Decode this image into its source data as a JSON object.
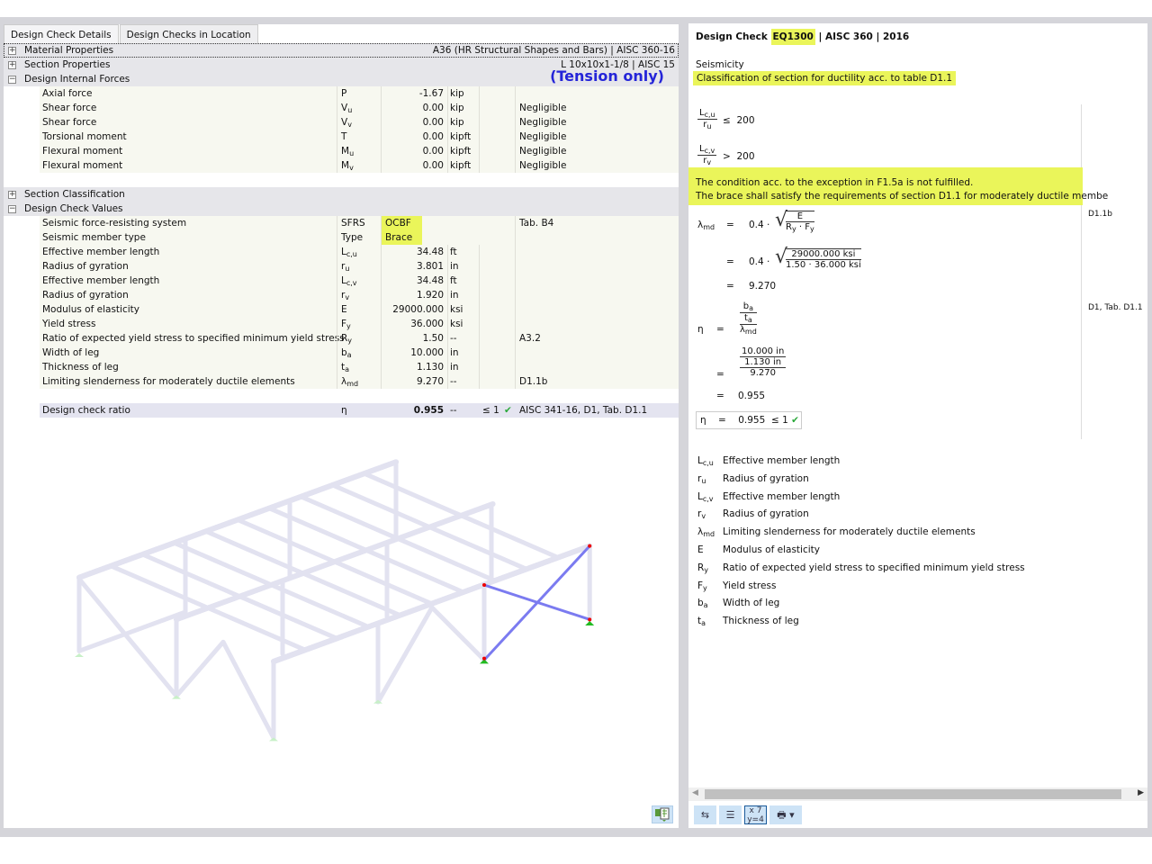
{
  "tabs": [
    "Design Check Details",
    "Design Checks in Location"
  ],
  "sections": {
    "material": {
      "label": "Material Properties",
      "value": "A36 (HR Structural Shapes and Bars) | AISC 360-16"
    },
    "section": {
      "label": "Section Properties",
      "value": "L 10x10x1-1/8 | AISC 15"
    },
    "forces": {
      "label": "Design Internal Forces",
      "note": "(Tension only)"
    },
    "classification": {
      "label": "Section Classification"
    },
    "values": {
      "label": "Design Check Values"
    }
  },
  "forces": [
    {
      "name": "Axial force",
      "sym": "P",
      "sub": "",
      "val": "-1.67",
      "unit": "kip",
      "ref": ""
    },
    {
      "name": "Shear force",
      "sym": "V",
      "sub": "u",
      "val": "0.00",
      "unit": "kip",
      "ref": "Negligible"
    },
    {
      "name": "Shear force",
      "sym": "V",
      "sub": "v",
      "val": "0.00",
      "unit": "kip",
      "ref": "Negligible"
    },
    {
      "name": "Torsional moment",
      "sym": "T",
      "sub": "",
      "val": "0.00",
      "unit": "kipft",
      "ref": "Negligible"
    },
    {
      "name": "Flexural moment",
      "sym": "M",
      "sub": "u",
      "val": "0.00",
      "unit": "kipft",
      "ref": "Negligible"
    },
    {
      "name": "Flexural moment",
      "sym": "M",
      "sub": "v",
      "val": "0.00",
      "unit": "kipft",
      "ref": "Negligible"
    }
  ],
  "values": [
    {
      "name": "Seismic force-resisting system",
      "sym": "SFRS",
      "sub": "",
      "val": "OCBF",
      "unit": "",
      "ref": "Tab. B4",
      "hl": true
    },
    {
      "name": "Seismic member type",
      "sym": "Type",
      "sub": "",
      "val": "Brace",
      "unit": "",
      "ref": "",
      "hl": true
    },
    {
      "name": "Effective member length",
      "sym": "L",
      "sub": "c,u",
      "val": "34.48",
      "unit": "ft",
      "ref": ""
    },
    {
      "name": "Radius of gyration",
      "sym": "r",
      "sub": "u",
      "val": "3.801",
      "unit": "in",
      "ref": ""
    },
    {
      "name": "Effective member length",
      "sym": "L",
      "sub": "c,v",
      "val": "34.48",
      "unit": "ft",
      "ref": ""
    },
    {
      "name": "Radius of gyration",
      "sym": "r",
      "sub": "v",
      "val": "1.920",
      "unit": "in",
      "ref": ""
    },
    {
      "name": "Modulus of elasticity",
      "sym": "E",
      "sub": "",
      "val": "29000.000",
      "unit": "ksi",
      "ref": ""
    },
    {
      "name": "Yield stress",
      "sym": "F",
      "sub": "y",
      "val": "36.000",
      "unit": "ksi",
      "ref": ""
    },
    {
      "name": "Ratio of expected yield stress to specified minimum yield stress",
      "sym": "R",
      "sub": "y",
      "val": "1.50",
      "unit": "--",
      "ref": "A3.2"
    },
    {
      "name": "Width of leg",
      "sym": "b",
      "sub": "a",
      "val": "10.000",
      "unit": "in",
      "ref": ""
    },
    {
      "name": "Thickness of leg",
      "sym": "t",
      "sub": "a",
      "val": "1.130",
      "unit": "in",
      "ref": ""
    },
    {
      "name": "Limiting slenderness for moderately ductile elements",
      "sym": "λ",
      "sub": "md",
      "val": "9.270",
      "unit": "--",
      "ref": "D1.1b"
    }
  ],
  "ratio": {
    "name": "Design check ratio",
    "sym": "η",
    "val": "0.955",
    "unit": "--",
    "chk": "≤ 1",
    "ref": "AISC 341-16, D1, Tab. D1.1"
  },
  "right": {
    "title_pre": "Design Check",
    "title_code": "EQ1300",
    "title_post": "| AISC 360 | 2016",
    "category": "Seismicity",
    "subtitle": "Classification of section for ductility acc. to table D1.1",
    "cond1": {
      "num": "L",
      "num_sub": "c,u",
      "den": "r",
      "den_sub": "u",
      "op": "≤",
      "val": "200"
    },
    "cond2": {
      "num": "L",
      "num_sub": "c,v",
      "den": "r",
      "den_sub": "v",
      "op": ">",
      "val": "200"
    },
    "msg1": "The condition acc. to the exception in F1.5a is not fulfilled.",
    "msg2": "The brace shall satisfy the requirements of section D1.1 for moderately ductile membe",
    "lam_ref": "D1.1b",
    "eta_ref": "D1, Tab. D1.1",
    "f_lam": "λ",
    "f_lam_sub": "md",
    "f_eq": "=",
    "f_coef": "0.4 ·",
    "f_E": "E",
    "f_Ry": "R",
    "f_Ry_sub": "y",
    "f_Fy": "F",
    "f_Fy_sub": "y",
    "f_dot": "·",
    "f_Eval": "29000.000 ksi",
    "f_Ryval": "1.50",
    "f_Fyval": "36.000 ksi",
    "f_lamres": "9.270",
    "f_eta": "η",
    "f_b": "b",
    "f_b_sub": "a",
    "f_t": "t",
    "f_t_sub": "a",
    "f_bval": "10.000 in",
    "f_tval": "1.130 in",
    "f_lamval": "9.270",
    "f_etares": "0.955",
    "result_val": "0.955",
    "result_chk": "≤ 1"
  },
  "legend": [
    {
      "sym": "L",
      "sub": "c,u",
      "desc": "Effective member length"
    },
    {
      "sym": "r",
      "sub": "u",
      "desc": "Radius of gyration"
    },
    {
      "sym": "L",
      "sub": "c,v",
      "desc": "Effective member length"
    },
    {
      "sym": "r",
      "sub": "v",
      "desc": "Radius of gyration"
    },
    {
      "sym": "λ",
      "sub": "md",
      "desc": "Limiting slenderness for moderately ductile elements"
    },
    {
      "sym": "E",
      "sub": "",
      "desc": "Modulus of elasticity"
    },
    {
      "sym": "R",
      "sub": "y",
      "desc": "Ratio of expected yield stress to specified minimum yield stress"
    },
    {
      "sym": "F",
      "sub": "y",
      "desc": "Yield stress"
    },
    {
      "sym": "b",
      "sub": "a",
      "desc": "Width of leg"
    },
    {
      "sym": "t",
      "sub": "a",
      "desc": "Thickness of leg"
    }
  ],
  "toolbar": [
    "display-settings-icon",
    "numbering-icon",
    "formula-icon",
    "print-icon"
  ],
  "colors": {
    "highlight": "#eaf55a",
    "tension": "#2424d8",
    "check": "#2aa83a",
    "member": "#7b7bf0"
  }
}
